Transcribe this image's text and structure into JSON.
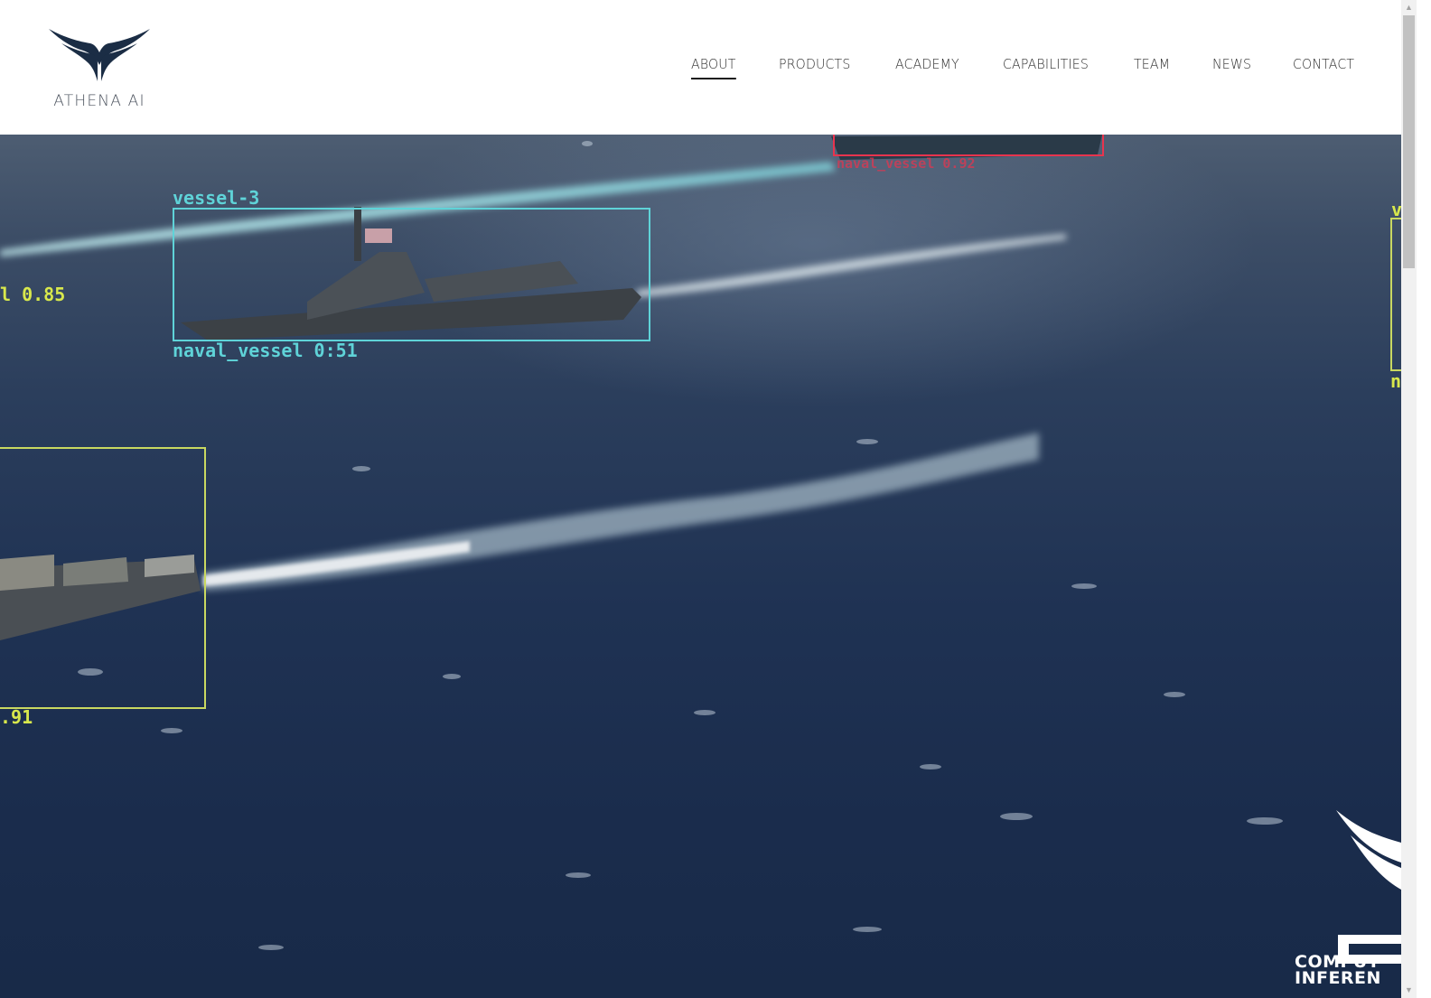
{
  "brand": {
    "name": "ATHENA AI",
    "logo_color": "#1b2d45"
  },
  "nav": {
    "items": [
      {
        "label": "ABOUT",
        "active": true
      },
      {
        "label": "PRODUCTS",
        "active": false
      },
      {
        "label": "ACADEMY",
        "active": false
      },
      {
        "label": "CAPABILITIES",
        "active": false
      },
      {
        "label": "TEAM",
        "active": false
      },
      {
        "label": "NEWS",
        "active": false
      },
      {
        "label": "CONTACT",
        "active": false
      }
    ]
  },
  "hero": {
    "background_color": "#1f3253",
    "detections": [
      {
        "id_label": "vessel-3",
        "class_label": "naval_vessel 0:51",
        "color": "#5fd3d8"
      },
      {
        "id_label": "",
        "class_label": "l 0.85",
        "color": "#d8e84c"
      },
      {
        "id_label": "",
        "class_label": ".91",
        "color": "#d8e84c"
      },
      {
        "id_label": "v",
        "class_label": "n",
        "color": "#d8e84c"
      },
      {
        "id_label": "",
        "class_label": "naval_vessel 0.92",
        "color": "#e8344e"
      }
    ],
    "partner_logo": {
      "line1": "COMPUT",
      "line2": "INFEREN"
    }
  },
  "scrollbar": {
    "up_arrow": "▲",
    "down_arrow": "▼"
  }
}
